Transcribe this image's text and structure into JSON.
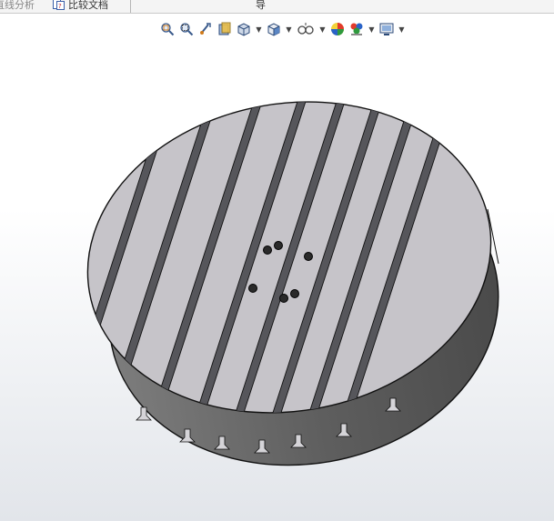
{
  "command_bar": {
    "tab_partial_label": "直线分析",
    "compare_label": "比较文档",
    "right_partial_label": "导"
  },
  "view_toolbar": {
    "buttons": [
      {
        "name": "zoom-to-fit-icon"
      },
      {
        "name": "zoom-to-area-icon"
      },
      {
        "name": "previous-view-icon"
      },
      {
        "name": "section-view-icon"
      },
      {
        "name": "dynamic-annotation-icon",
        "dropdown": true
      },
      {
        "name": "view-orientation-icon",
        "dropdown": true
      },
      {
        "name": "display-style-icon",
        "dropdown": true
      },
      {
        "name": "hide-show-items-icon",
        "dropdown": true
      },
      {
        "name": "edit-appearance-icon"
      },
      {
        "name": "apply-scene-icon",
        "dropdown": true
      },
      {
        "name": "view-settings-icon",
        "dropdown": true
      }
    ]
  },
  "model": {
    "description_colors": {
      "top_face": "#c6c4c9",
      "side_face": "#6b6b6b",
      "slot": "#55555a",
      "edge": "#111111"
    }
  }
}
